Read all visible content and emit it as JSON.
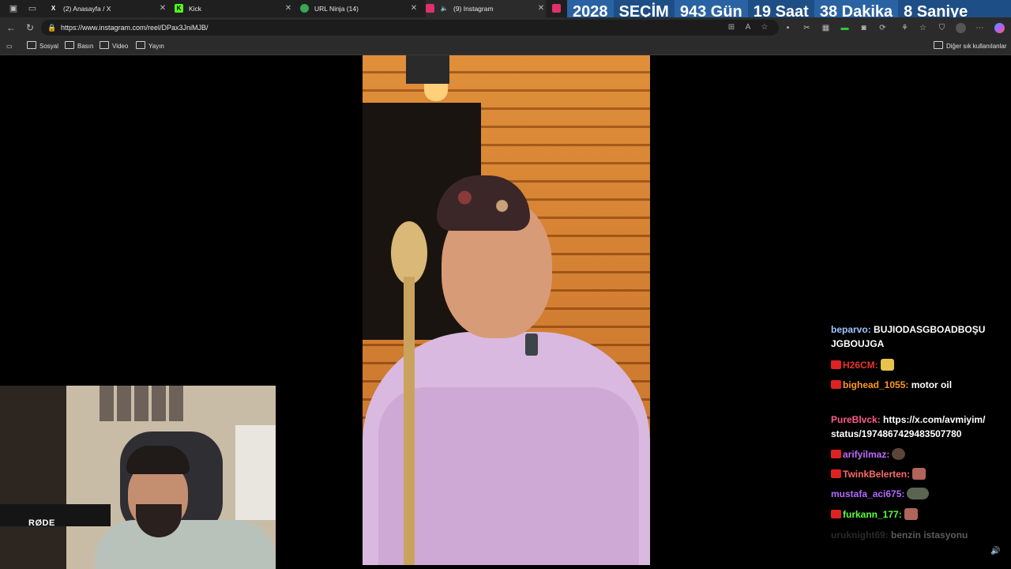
{
  "tabs": [
    {
      "title": "(2) Anasayfa / X",
      "favicon": "X",
      "favicon_color": "#ffffff"
    },
    {
      "title": "Kick",
      "favicon": "K",
      "favicon_color": "#53fc18"
    },
    {
      "title": "URL Ninja (14)",
      "favicon": "ninja",
      "favicon_color": "#3aa655"
    },
    {
      "title": "(9) Instagram",
      "favicon": "instagram",
      "favicon_color": "#e1306c"
    }
  ],
  "countdown": {
    "year": "2028",
    "label": "SEÇİM",
    "days": "943 Gün",
    "hours": "19 Saat",
    "minutes": "38 Dakika",
    "seconds": "8 Saniye"
  },
  "address_bar": {
    "url": "https://www.instagram.com/reel/DPax3JniMJB/"
  },
  "bookmarks": {
    "items": [
      "Sosyal",
      "Basın",
      "Video",
      "Yayın"
    ],
    "other_bookmarks": "Diğer sık kullanılanlar"
  },
  "webcam": {
    "mic_brand": "RØDE"
  },
  "chat": {
    "messages": [
      {
        "user": "beparvo",
        "color": "#9ec6ff",
        "badge": false,
        "text": "BUJIODASGBOADBOŞU JGBOUJGA",
        "emote": null
      },
      {
        "user": "H26CM",
        "color": "#e8312a",
        "badge": true,
        "text": "",
        "emote": "laugh-emote"
      },
      {
        "user": "bighead_1055",
        "color": "#ff9a1f",
        "badge": true,
        "text": "motor oil",
        "emote": null
      },
      {
        "user": "PureBlvck",
        "color": "#ff5c8a",
        "badge": false,
        "text": "https://x.com/avmiyim/ status/1974867429483507780",
        "emote": null
      },
      {
        "user": "arifyilmaz",
        "color": "#c06bff",
        "badge": true,
        "text": "",
        "emote": "face-emote"
      },
      {
        "user": "TwinkBelerten",
        "color": "#ff6a6a",
        "badge": true,
        "text": "",
        "emote": "face-emote-2"
      },
      {
        "user": "mustafa_aci675",
        "color": "#b16bff",
        "badge": false,
        "text": "",
        "emote": "car-emote"
      },
      {
        "user": "furkann_177",
        "color": "#5dff3a",
        "badge": true,
        "text": "",
        "emote": "face-emote-3"
      },
      {
        "user": "uruknight69",
        "color": "#777777",
        "badge": false,
        "text": "benzin istasyonu",
        "emote": null
      }
    ]
  }
}
